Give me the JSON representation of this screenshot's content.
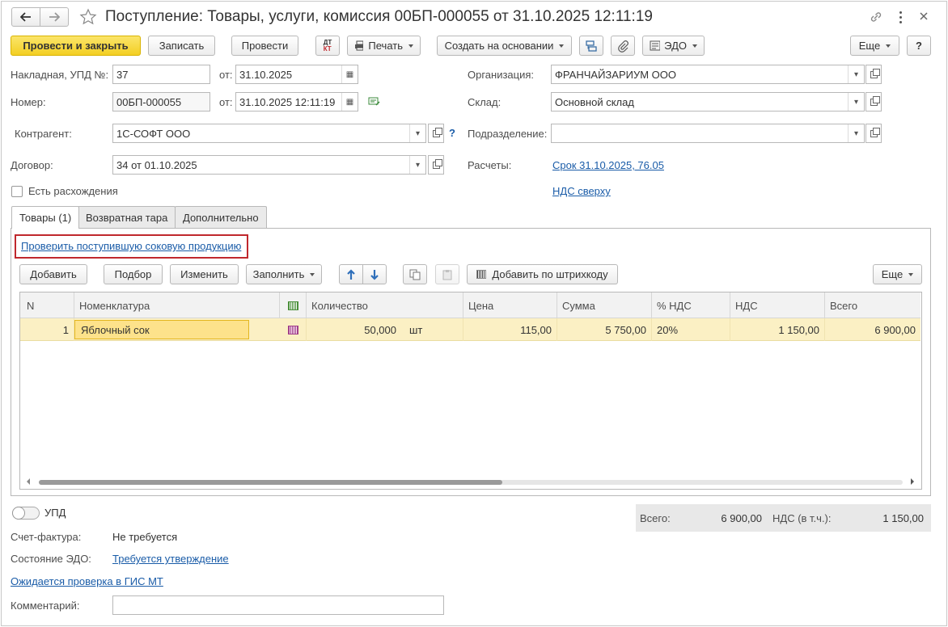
{
  "window": {
    "title": "Поступление: Товары, услуги, комиссия 00БП-000055 от 31.10.2025 12:11:19"
  },
  "toolbar": {
    "post_close": "Провести и закрыть",
    "save": "Записать",
    "post": "Провести",
    "dtkt": "ДТ КТ",
    "print": "Печать",
    "create_based": "Создать на основании",
    "edo": "ЭДО",
    "more": "Еще",
    "help": "?"
  },
  "form": {
    "invoice_label": "Накладная, УПД №:",
    "invoice_value": "37",
    "from_label": "от:",
    "invoice_date": "31.10.2025",
    "number_label": "Номер:",
    "number_value": "00БП-000055",
    "number_date": "31.10.2025 12:11:19",
    "counterparty_label": "Контрагент:",
    "counterparty_value": "1С-СОФТ ООО",
    "help_mark": "?",
    "contract_label": "Договор:",
    "contract_value": "34 от 01.10.2025",
    "discrepancy_label": "Есть расхождения",
    "org_label": "Организация:",
    "org_value": "ФРАНЧАЙЗАРИУМ ООО",
    "warehouse_label": "Склад:",
    "warehouse_value": "Основной склад",
    "subdivision_label": "Подразделение:",
    "subdivision_value": "",
    "settlements_label": "Расчеты:",
    "settlements_link": "Срок 31.10.2025, 76.05",
    "vat_link": "НДС сверху"
  },
  "tabs": [
    {
      "label": "Товары (1)"
    },
    {
      "label": "Возвратная тара"
    },
    {
      "label": "Дополнительно"
    }
  ],
  "check_link": "Проверить поступившую соковую продукцию",
  "table_toolbar": {
    "add": "Добавить",
    "pick": "Подбор",
    "change": "Изменить",
    "fill": "Заполнить",
    "barcode_add": "Добавить по штрихкоду",
    "more": "Еще"
  },
  "table": {
    "columns": [
      "N",
      "Номенклатура",
      "Количество",
      "Цена",
      "Сумма",
      "% НДС",
      "НДС",
      "Всего"
    ],
    "rows": [
      {
        "n": "1",
        "item": "Яблочный сок",
        "qty": "50,000",
        "unit": "шт",
        "price": "115,00",
        "sum": "5 750,00",
        "vat_rate": "20%",
        "vat": "1 150,00",
        "total": "6 900,00"
      }
    ]
  },
  "totals": {
    "total_label": "Всего:",
    "total_value": "6 900,00",
    "vat_label": "НДС (в т.ч.):",
    "vat_value": "1 150,00"
  },
  "footer": {
    "upd_label": "УПД",
    "invoice_label": "Счет-фактура:",
    "invoice_value": "Не требуется",
    "edo_label": "Состояние ЭДО:",
    "edo_link": "Требуется утверждение",
    "gis_link": "Ожидается проверка в ГИС МТ",
    "comment_label": "Комментарий:",
    "comment_value": ""
  },
  "colors": {
    "primary_button": "#f3cf23",
    "selected_row": "#fbf0c4",
    "link": "#1a5ca8",
    "highlight_frame": "#c0282d"
  }
}
